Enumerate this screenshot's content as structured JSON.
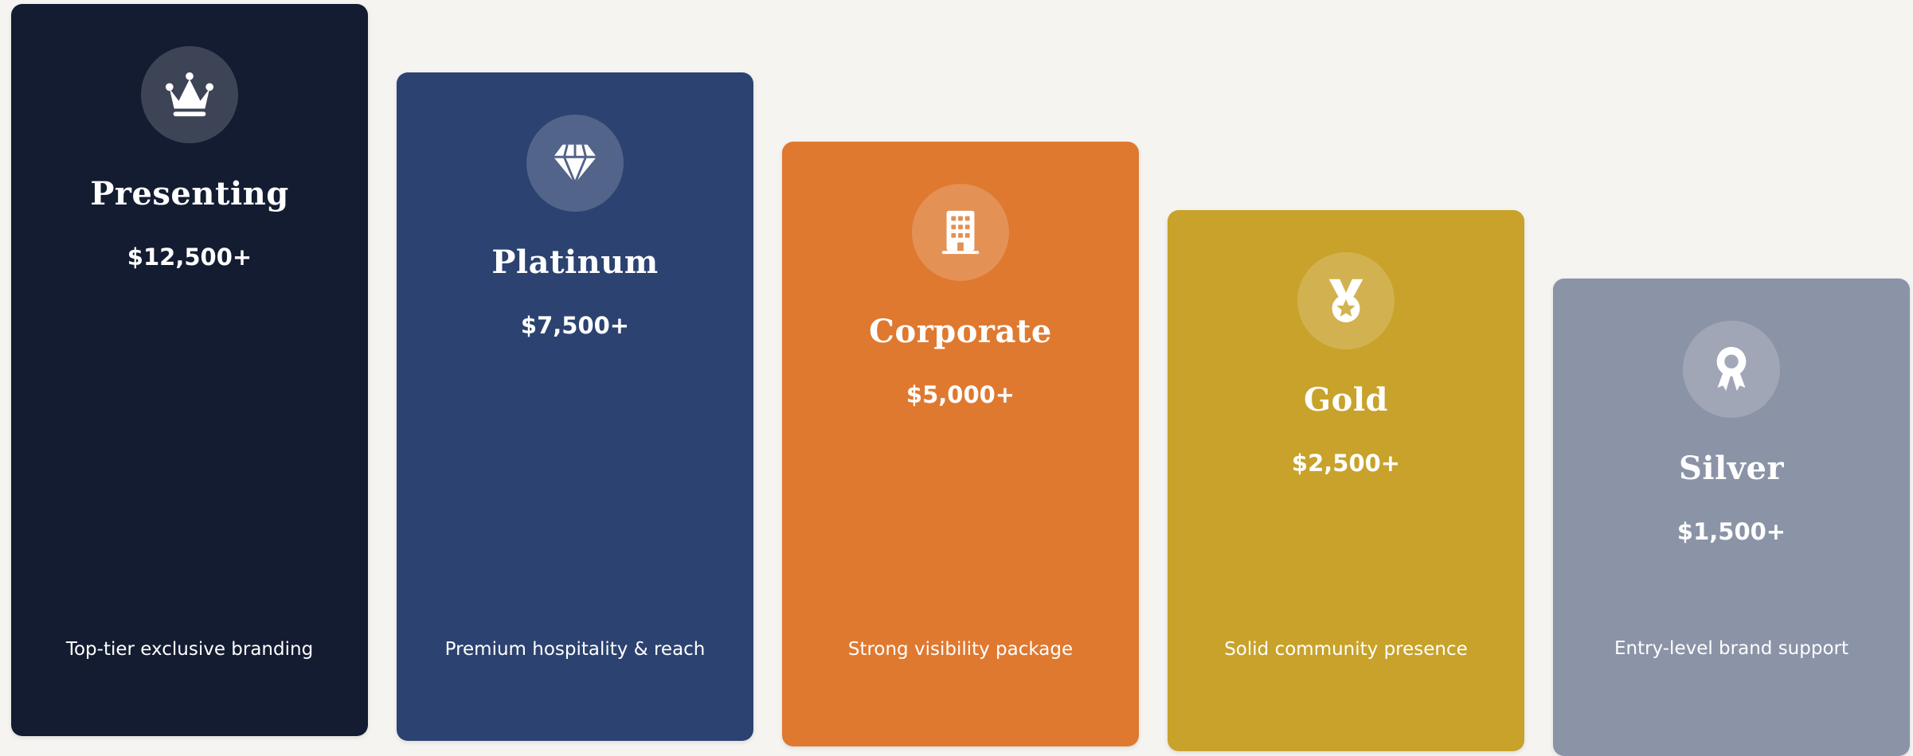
{
  "tiers": [
    {
      "name": "Presenting",
      "price": "$12,500+",
      "description": "Top-tier exclusive branding",
      "icon": "crown-icon",
      "color": "#131c31"
    },
    {
      "name": "Platinum",
      "price": "$7,500+",
      "description": "Premium hospitality & reach",
      "icon": "diamond-icon",
      "color": "#2c4270"
    },
    {
      "name": "Corporate",
      "price": "$5,000+",
      "description": "Strong visibility package",
      "icon": "building-icon",
      "color": "#df7930"
    },
    {
      "name": "Gold",
      "price": "$2,500+",
      "description": "Solid community presence",
      "icon": "medal-icon",
      "color": "#c8a22a"
    },
    {
      "name": "Silver",
      "price": "$1,500+",
      "description": "Entry-level brand support",
      "icon": "award-ribbon-icon",
      "color": "#8b93a7"
    }
  ],
  "background_color": "#f5f4f1"
}
